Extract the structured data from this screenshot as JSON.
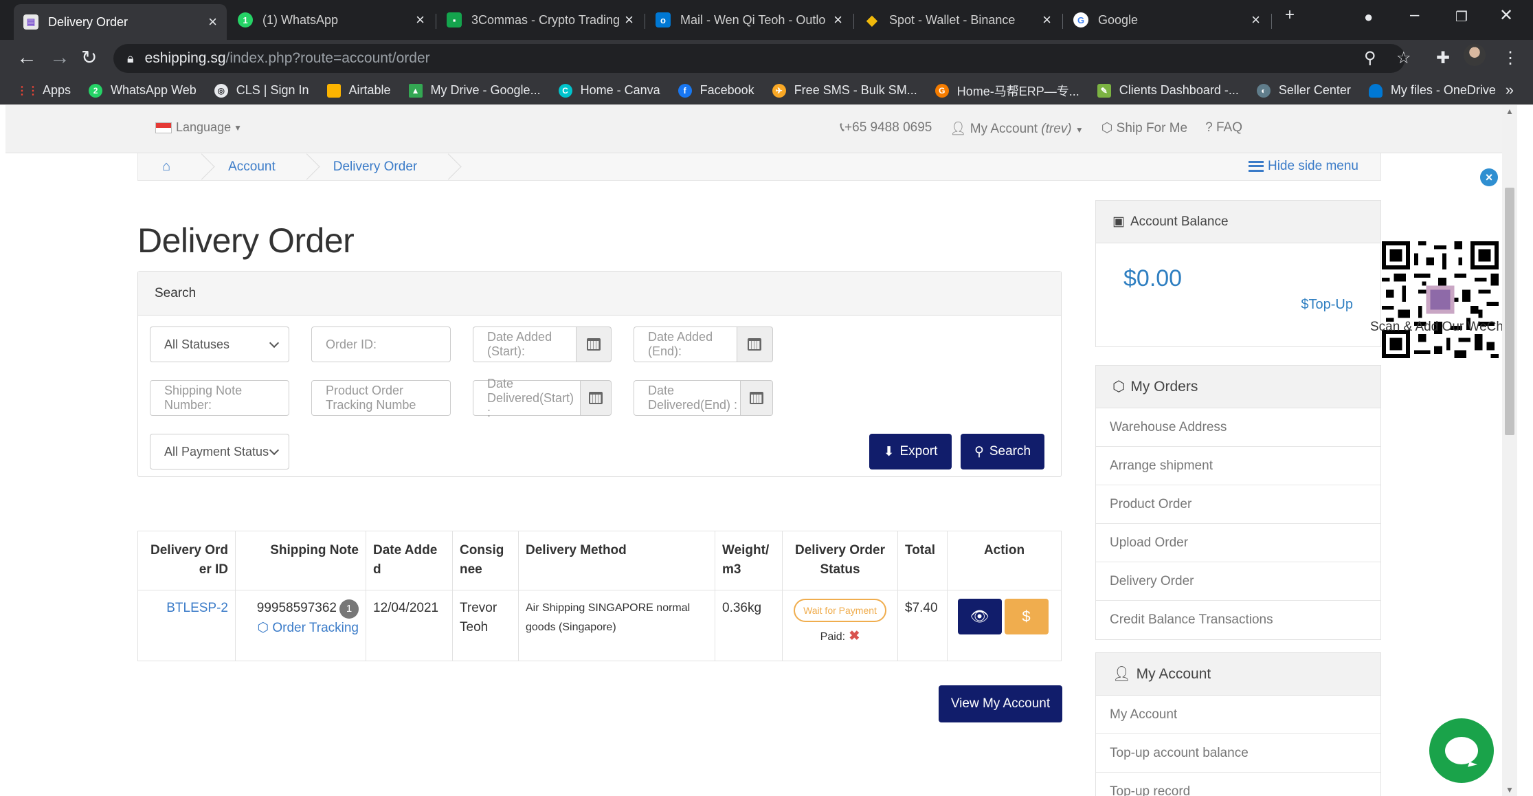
{
  "browser": {
    "tabs": [
      {
        "title": "Delivery Order",
        "active": true
      },
      {
        "title": "(1) WhatsApp",
        "active": false
      },
      {
        "title": "3Commas - Crypto Trading",
        "active": false
      },
      {
        "title": "Mail - Wen Qi Teoh - Outlo",
        "active": false
      },
      {
        "title": "Spot - Wallet - Binance",
        "active": false
      },
      {
        "title": "Google",
        "active": false
      }
    ],
    "url_host": "eshipping.sg",
    "url_path": "/index.php?route=account/order",
    "bookmarks": [
      {
        "label": "Apps",
        "color": "#4285f4"
      },
      {
        "label": "WhatsApp Web",
        "color": "#25d366"
      },
      {
        "label": "CLS | Sign In",
        "color": "#5f6368"
      },
      {
        "label": "Airtable",
        "color": "#fcb400"
      },
      {
        "label": "My Drive - Google...",
        "color": "#34a853"
      },
      {
        "label": "Home - Canva",
        "color": "#00c4cc"
      },
      {
        "label": "Facebook",
        "color": "#1877f2"
      },
      {
        "label": "Free SMS - Bulk SM...",
        "color": "#f9a825"
      },
      {
        "label": "Home-马帮ERP—专...",
        "color": "#f57c00"
      },
      {
        "label": "Clients Dashboard -...",
        "color": "#7cb342"
      },
      {
        "label": "Seller Center",
        "color": "#607d8b"
      },
      {
        "label": "My files - OneDrive",
        "color": "#0078d4"
      }
    ],
    "bookmarks_more": "»"
  },
  "topbar": {
    "language": "Language",
    "phone": "+65 9488 0695",
    "account_label": "My Account",
    "account_user": "(trev)",
    "ship_for_me": "Ship For Me",
    "faq": "FAQ"
  },
  "breadcrumb": {
    "items": [
      "Account",
      "Delivery Order"
    ],
    "hide_side_menu": "Hide side menu"
  },
  "page_title": "Delivery Order",
  "search": {
    "heading": "Search",
    "status_select": "All Statuses",
    "order_id_placeholder": "Order ID:",
    "date_added_start": "Date Added (Start):",
    "date_added_end": "Date Added (End):",
    "shipping_note_placeholder": "Shipping Note Number:",
    "tracking_placeholder": "Product Order Tracking Numbe",
    "date_delivered_start": "Date Delivered(Start) :",
    "date_delivered_end": "Date Delivered(End) :",
    "payment_select": "All Payment Status",
    "export_label": "Export",
    "search_label": "Search"
  },
  "table": {
    "headers": [
      "Delivery Ord er ID",
      "Shipping Note",
      "Date Adde d",
      "Consig nee",
      "Delivery Method",
      "Weight/ m3",
      "Delivery Order Status",
      "Total",
      "Action"
    ],
    "rows": [
      {
        "order_id": "BTLESP-2",
        "shipping_note": "99958597362",
        "note_count": "1",
        "tracking_link": "Order Tracking",
        "date_added": "12/04/2021",
        "consignee": "Trevor Teoh",
        "delivery_method": "Air Shipping SINGAPORE normal goods (Singapore)",
        "weight": "0.36kg",
        "status": "Wait for Payment",
        "paid_label": "Paid:",
        "paid_mark": "✖",
        "total": "$7.40"
      }
    ]
  },
  "view_account_button": "View My Account",
  "sidebar": {
    "balance_title": "Account Balance",
    "balance_amount": "$0.00",
    "topup_label": "Top-Up",
    "orders_title": "My Orders",
    "orders_items": [
      "Warehouse Address",
      "Arrange shipment",
      "Product Order",
      "Upload Order",
      "Delivery Order",
      "Credit Balance Transactions"
    ],
    "account_title": "My Account",
    "account_items": [
      "My Account",
      "Top-up account balance",
      "Top-up record"
    ]
  },
  "wechat_caption": "Scan & Add Our WeChat",
  "colors": {
    "primary_button": "#111d6b",
    "link": "#3a7bc8",
    "warning": "#f0ad4e",
    "chat": "#1aa34a"
  }
}
